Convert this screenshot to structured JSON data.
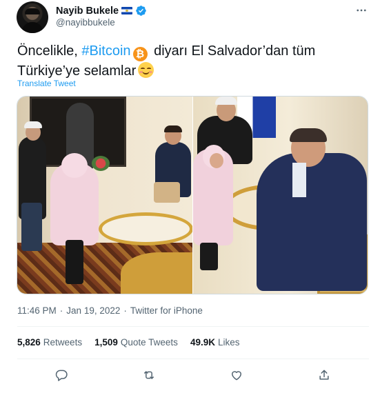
{
  "header": {
    "display_name": "Nayib Bukele",
    "handle": "@nayibbukele"
  },
  "tweet": {
    "text_part1": "Öncelikle, ",
    "hashtag": "#Bitcoin",
    "text_part2": " diyarı El Salvador’dan tüm Türkiye’ye selamlar",
    "translate_label": "Translate Tweet"
  },
  "media": {
    "photo_count": 2
  },
  "meta": {
    "time": "11:46 PM",
    "date": "Jan 19, 2022",
    "separator": "·",
    "source": "Twitter for iPhone"
  },
  "stats": [
    {
      "value": "5,826",
      "label": "Retweets"
    },
    {
      "value": "1,509",
      "label": "Quote Tweets"
    },
    {
      "value": "49.9K",
      "label": "Likes"
    }
  ],
  "icons": {
    "more": "more-dots-icon",
    "verified": "verified-badge-icon",
    "flag": "el-salvador-flag-icon",
    "bitcoin": "bitcoin-icon",
    "smile": "smiling-face-icon",
    "reply": "reply-icon",
    "retweet": "retweet-icon",
    "like": "like-heart-icon",
    "share": "share-icon"
  },
  "colors": {
    "link": "#1d9bf0",
    "text": "#0f1419",
    "muted": "#536471",
    "bitcoin": "#f7931a"
  }
}
